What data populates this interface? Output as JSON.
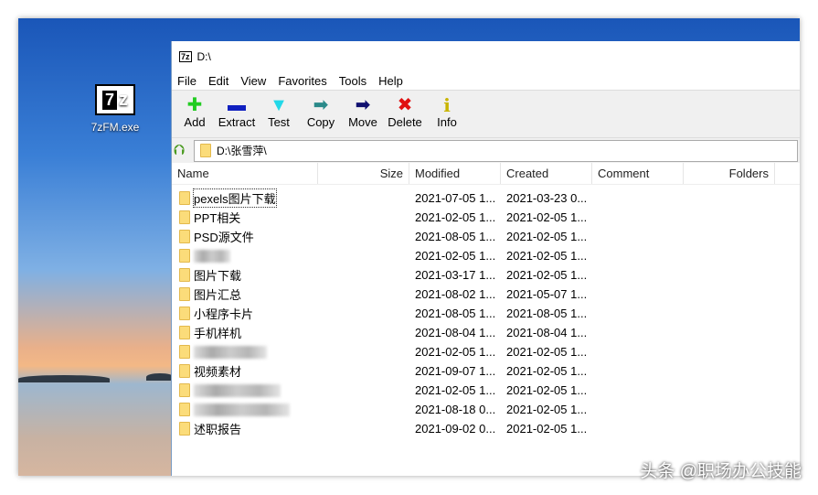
{
  "desktop": {
    "icon_label": "7zFM.exe"
  },
  "window": {
    "title": "D:\\"
  },
  "menu": [
    "File",
    "Edit",
    "View",
    "Favorites",
    "Tools",
    "Help"
  ],
  "toolbar": [
    {
      "label": "Add",
      "icon": "plus-icon",
      "color": "#22cc22",
      "glyph": "✚"
    },
    {
      "label": "Extract",
      "icon": "minus-icon",
      "color": "#1020c0",
      "glyph": "▬"
    },
    {
      "label": "Test",
      "icon": "check-chevron-icon",
      "color": "#22d8e8",
      "glyph": "▼"
    },
    {
      "label": "Copy",
      "icon": "copy-arrow-icon",
      "color": "#2a8a8a",
      "glyph": "➡"
    },
    {
      "label": "Move",
      "icon": "move-arrow-icon",
      "color": "#101070",
      "glyph": "➡"
    },
    {
      "label": "Delete",
      "icon": "delete-x-icon",
      "color": "#e01010",
      "glyph": "✖"
    },
    {
      "label": "Info",
      "icon": "info-icon",
      "color": "#c8b400",
      "glyph": "i"
    }
  ],
  "address": "D:\\张雪萍\\",
  "columns": [
    "Name",
    "Size",
    "Modified",
    "Created",
    "Comment",
    "Folders"
  ],
  "rows": [
    {
      "name": "pexels图片下载",
      "modified": "2021-07-05 1...",
      "created": "2021-03-23 0..."
    },
    {
      "name": "PPT相关",
      "modified": "2021-02-05 1...",
      "created": "2021-02-05 1..."
    },
    {
      "name": "PSD源文件",
      "modified": "2021-08-05 1...",
      "created": "2021-02-05 1..."
    },
    {
      "name": "",
      "modified": "2021-02-05 1...",
      "created": "2021-02-05 1..."
    },
    {
      "name": "图片下载",
      "modified": "2021-03-17 1...",
      "created": "2021-02-05 1..."
    },
    {
      "name": "图片汇总",
      "modified": "2021-08-02 1...",
      "created": "2021-05-07 1..."
    },
    {
      "name": "小程序卡片",
      "modified": "2021-08-05 1...",
      "created": "2021-08-05 1..."
    },
    {
      "name": "手机样机",
      "modified": "2021-08-04 1...",
      "created": "2021-08-04 1..."
    },
    {
      "name": "",
      "modified": "2021-02-05 1...",
      "created": "2021-02-05 1..."
    },
    {
      "name": "视频素材",
      "modified": "2021-09-07 1...",
      "created": "2021-02-05 1..."
    },
    {
      "name": "",
      "modified": "2021-02-05 1...",
      "created": "2021-02-05 1..."
    },
    {
      "name": "",
      "modified": "2021-08-18 0...",
      "created": "2021-02-05 1..."
    },
    {
      "name": "述职报告",
      "modified": "2021-09-02 0...",
      "created": "2021-02-05 1..."
    }
  ],
  "watermark": "头条 @职场办公技能"
}
